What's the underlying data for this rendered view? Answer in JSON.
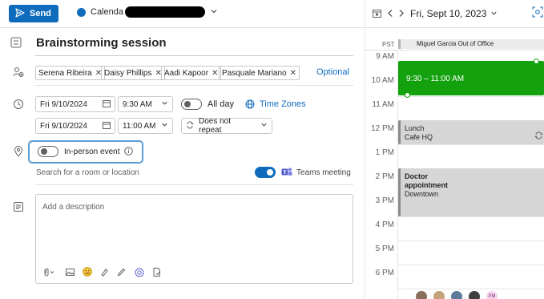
{
  "toolbar": {
    "send_label": "Send",
    "calendar_label": "Calenda",
    "accent": "#0f6cbd"
  },
  "event": {
    "title": "Brainstorming session",
    "attendees": [
      "Serena Ribeira",
      "Daisy Phillips",
      "Aadi Kapoor",
      "Pasquale Mariano"
    ],
    "optional_label": "Optional",
    "start_date": "Fri 9/10/2024",
    "start_time": "9:30 AM",
    "all_day_label": "All day",
    "time_zones_label": "Time Zones",
    "end_date": "Fri 9/10/2024",
    "end_time": "11:00 AM",
    "repeat_label": "Does not repeat",
    "in_person_label": "In-person event",
    "location_placeholder": "Search for a room or location",
    "teams_label": "Teams meeting",
    "teams_on": true,
    "description_placeholder": "Add a description"
  },
  "calendar": {
    "date_label": "Fri, Sept 10, 2023",
    "tz_label": "PST",
    "allday_event": "Miguel Garcia Out of Office",
    "hours": [
      "9 AM",
      "10 AM",
      "11 AM",
      "12 PM",
      "1 PM",
      "2 PM",
      "3 PM",
      "4 PM",
      "5 PM",
      "6 PM"
    ],
    "events": {
      "new_time": "9:30 – 11:00 AM",
      "lunch_title": "Lunch",
      "lunch_location": "Cafe HQ",
      "doctor_title_1": "Doctor",
      "doctor_title_2": "appointment",
      "doctor_location": "Downtown"
    },
    "colors": {
      "new_event": "#13a10e",
      "busy_event": "#d6d6d6",
      "busy_bar": "#8a8a8a"
    },
    "avatar_initials": "PM"
  }
}
